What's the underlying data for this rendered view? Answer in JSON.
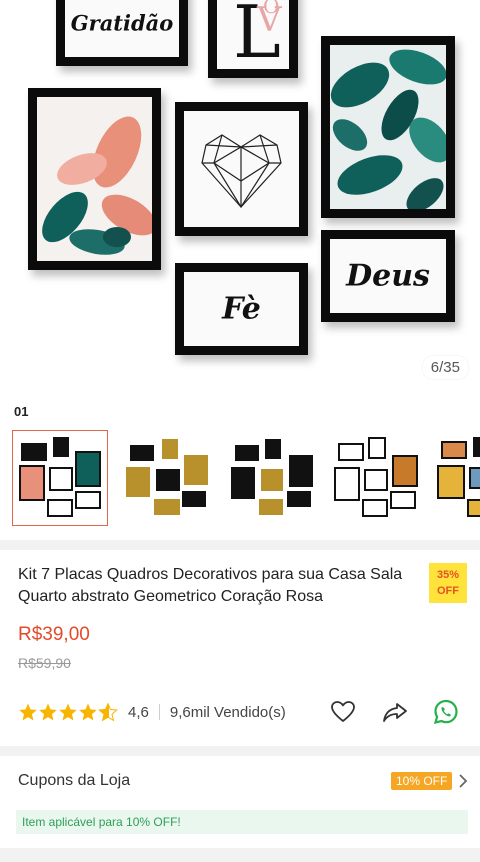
{
  "gallery": {
    "counter": "6/35",
    "frames": {
      "gratidao": "Gratidão",
      "fe": "Fè",
      "deus": "Deus"
    }
  },
  "variation": {
    "label": "01",
    "thumbnails": [
      "variant-1",
      "variant-2",
      "variant-3",
      "variant-4",
      "variant-5"
    ],
    "selected_index": 0
  },
  "product": {
    "title": "Kit 7 Placas Quadros Decorativos para sua Casa Sala Quarto abstrato Geometrico Coração Rosa",
    "discount_badge": {
      "percent": "35%",
      "text": "OFF"
    },
    "price": "R$39,00",
    "original_price": "R$59,90",
    "rating": "4,6",
    "rating_stars": 4.5,
    "sold": "9,6mil Vendido(s)"
  },
  "actions": [
    "heart-icon",
    "share-icon",
    "whatsapp-icon"
  ],
  "coupons": {
    "label": "Cupons da Loja",
    "badge": "10% OFF",
    "note": "Item aplicável para 10% OFF!"
  },
  "colors": {
    "accent": "#e34a2a",
    "badge_yellow": "#ffe23a",
    "coupon_orange": "#f5a623",
    "success_green": "#2f9e57",
    "leaf_teal": "#14665f",
    "leaf_pink": "#e8907a"
  }
}
